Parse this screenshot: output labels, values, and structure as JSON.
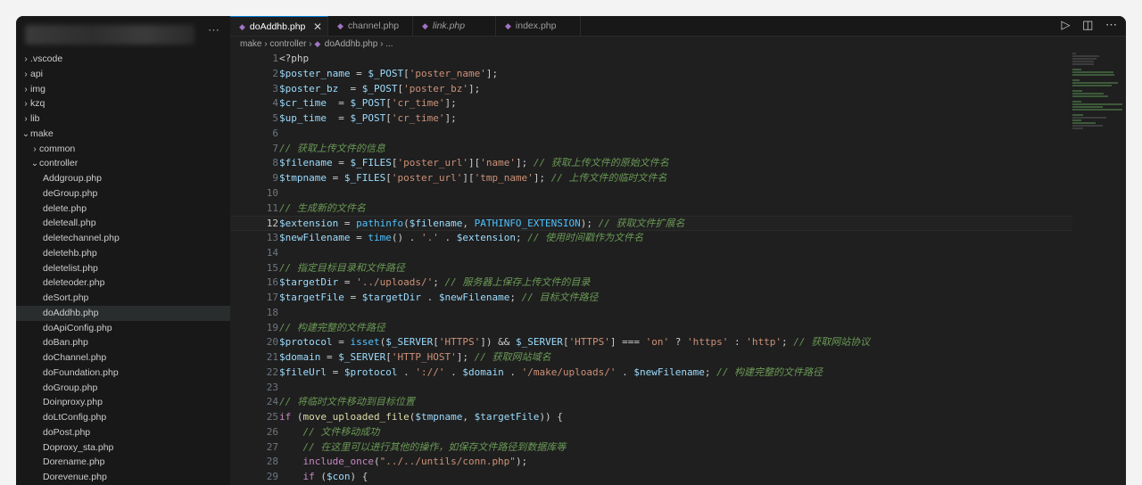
{
  "sidebar": {
    "more_label": "⋯",
    "items": [
      {
        "label": ".vscode",
        "type": "folder",
        "open": false,
        "indent": 0
      },
      {
        "label": "api",
        "type": "folder",
        "open": false,
        "indent": 0
      },
      {
        "label": "img",
        "type": "folder",
        "open": false,
        "indent": 0
      },
      {
        "label": "kzq",
        "type": "folder",
        "open": false,
        "indent": 0
      },
      {
        "label": "lib",
        "type": "folder",
        "open": false,
        "indent": 0
      },
      {
        "label": "make",
        "type": "folder",
        "open": true,
        "indent": 0
      },
      {
        "label": "common",
        "type": "folder",
        "open": false,
        "indent": 1
      },
      {
        "label": "controller",
        "type": "folder",
        "open": true,
        "indent": 1
      },
      {
        "label": "Addgroup.php",
        "type": "file",
        "indent": 2
      },
      {
        "label": "deGroup.php",
        "type": "file",
        "indent": 2
      },
      {
        "label": "delete.php",
        "type": "file",
        "indent": 2
      },
      {
        "label": "deleteall.php",
        "type": "file",
        "indent": 2
      },
      {
        "label": "deletechannel.php",
        "type": "file",
        "indent": 2
      },
      {
        "label": "deletehb.php",
        "type": "file",
        "indent": 2
      },
      {
        "label": "deletelist.php",
        "type": "file",
        "indent": 2
      },
      {
        "label": "deleteoder.php",
        "type": "file",
        "indent": 2
      },
      {
        "label": "deSort.php",
        "type": "file",
        "indent": 2
      },
      {
        "label": "doAddhb.php",
        "type": "file",
        "indent": 2,
        "active": true
      },
      {
        "label": "doApiConfig.php",
        "type": "file",
        "indent": 2
      },
      {
        "label": "doBan.php",
        "type": "file",
        "indent": 2
      },
      {
        "label": "doChannel.php",
        "type": "file",
        "indent": 2
      },
      {
        "label": "doFoundation.php",
        "type": "file",
        "indent": 2
      },
      {
        "label": "doGroup.php",
        "type": "file",
        "indent": 2
      },
      {
        "label": "Doinproxy.php",
        "type": "file",
        "indent": 2
      },
      {
        "label": "doLtConfig.php",
        "type": "file",
        "indent": 2
      },
      {
        "label": "doPost.php",
        "type": "file",
        "indent": 2
      },
      {
        "label": "Doproxy_sta.php",
        "type": "file",
        "indent": 2
      },
      {
        "label": "Dorename.php",
        "type": "file",
        "indent": 2
      },
      {
        "label": "Dorevenue.php",
        "type": "file",
        "indent": 2
      }
    ]
  },
  "tabs": [
    {
      "label": "doAddhb.php",
      "active": true,
      "italic": false,
      "close": "✕"
    },
    {
      "label": "channel.php",
      "active": false,
      "italic": false
    },
    {
      "label": "link.php",
      "active": false,
      "italic": true
    },
    {
      "label": "index.php",
      "active": false,
      "italic": false
    }
  ],
  "editor_actions": {
    "run": "▷",
    "split": "◫",
    "more": "⋯"
  },
  "breadcrumb": {
    "parts": [
      "make",
      "controller"
    ],
    "file": "doAddhb.php",
    "tail": "..."
  },
  "colors": {
    "keyword": "#c586c0",
    "variable": "#9cdcfe",
    "string": "#ce9178",
    "function": "#dcdcaa",
    "builtin": "#4fc1ff",
    "comment": "#6a9955",
    "text": "#cccccc",
    "php_badge": "#a074c4",
    "accent": "#0078d4"
  },
  "current_line": 12,
  "code_lines": [
    [
      [
        "t",
        "<?php"
      ]
    ],
    [
      [
        "v",
        "$poster_name"
      ],
      [
        "t",
        " = "
      ],
      [
        "v",
        "$_POST"
      ],
      [
        "t",
        "["
      ],
      [
        "s",
        "'poster_name'"
      ],
      [
        "t",
        "];"
      ]
    ],
    [
      [
        "v",
        "$poster_bz"
      ],
      [
        "t",
        "  = "
      ],
      [
        "v",
        "$_POST"
      ],
      [
        "t",
        "["
      ],
      [
        "s",
        "'poster_bz'"
      ],
      [
        "t",
        "];"
      ]
    ],
    [
      [
        "v",
        "$cr_time"
      ],
      [
        "t",
        "  = "
      ],
      [
        "v",
        "$_POST"
      ],
      [
        "t",
        "["
      ],
      [
        "s",
        "'cr_time'"
      ],
      [
        "t",
        "];"
      ]
    ],
    [
      [
        "v",
        "$up_time"
      ],
      [
        "t",
        "  = "
      ],
      [
        "v",
        "$_POST"
      ],
      [
        "t",
        "["
      ],
      [
        "s",
        "'cr_time'"
      ],
      [
        "t",
        "];"
      ]
    ],
    [],
    [
      [
        "c",
        "// 获取上传文件的信息"
      ]
    ],
    [
      [
        "v",
        "$filename"
      ],
      [
        "t",
        " = "
      ],
      [
        "v",
        "$_FILES"
      ],
      [
        "t",
        "["
      ],
      [
        "s",
        "'poster_url'"
      ],
      [
        "t",
        "]["
      ],
      [
        "s",
        "'name'"
      ],
      [
        "t",
        "]; "
      ],
      [
        "c",
        "// 获取上传文件的原始文件名"
      ]
    ],
    [
      [
        "v",
        "$tmpname"
      ],
      [
        "t",
        " = "
      ],
      [
        "v",
        "$_FILES"
      ],
      [
        "t",
        "["
      ],
      [
        "s",
        "'poster_url'"
      ],
      [
        "t",
        "]["
      ],
      [
        "s",
        "'tmp_name'"
      ],
      [
        "t",
        "]; "
      ],
      [
        "c",
        "// 上传文件的临时文件名"
      ]
    ],
    [],
    [
      [
        "c",
        "// 生成新的文件名"
      ]
    ],
    [
      [
        "v",
        "$extension"
      ],
      [
        "t",
        " = "
      ],
      [
        "b",
        "pathinfo"
      ],
      [
        "t",
        "("
      ],
      [
        "v",
        "$filename"
      ],
      [
        "t",
        ", "
      ],
      [
        "b",
        "PATHINFO_EXTENSION"
      ],
      [
        "t",
        "); "
      ],
      [
        "c",
        "// 获取文件扩展名"
      ]
    ],
    [
      [
        "v",
        "$newFilename"
      ],
      [
        "t",
        " = "
      ],
      [
        "b",
        "time"
      ],
      [
        "t",
        "() . "
      ],
      [
        "s",
        "'.'"
      ],
      [
        "t",
        " . "
      ],
      [
        "v",
        "$extension"
      ],
      [
        "t",
        "; "
      ],
      [
        "c",
        "// 使用时间戳作为文件名"
      ]
    ],
    [],
    [
      [
        "c",
        "// 指定目标目录和文件路径"
      ]
    ],
    [
      [
        "v",
        "$targetDir"
      ],
      [
        "t",
        " = "
      ],
      [
        "s",
        "'../uploads/'"
      ],
      [
        "t",
        "; "
      ],
      [
        "c",
        "// 服务器上保存上传文件的目录"
      ]
    ],
    [
      [
        "v",
        "$targetFile"
      ],
      [
        "t",
        " = "
      ],
      [
        "v",
        "$targetDir"
      ],
      [
        "t",
        " . "
      ],
      [
        "v",
        "$newFilename"
      ],
      [
        "t",
        "; "
      ],
      [
        "c",
        "// 目标文件路径"
      ]
    ],
    [],
    [
      [
        "c",
        "// 构建完整的文件路径"
      ]
    ],
    [
      [
        "v",
        "$protocol"
      ],
      [
        "t",
        " = "
      ],
      [
        "b",
        "isset"
      ],
      [
        "t",
        "("
      ],
      [
        "v",
        "$_SERVER"
      ],
      [
        "t",
        "["
      ],
      [
        "s",
        "'HTTPS'"
      ],
      [
        "t",
        "]) && "
      ],
      [
        "v",
        "$_SERVER"
      ],
      [
        "t",
        "["
      ],
      [
        "s",
        "'HTTPS'"
      ],
      [
        "t",
        "] === "
      ],
      [
        "s",
        "'on'"
      ],
      [
        "t",
        " ? "
      ],
      [
        "s",
        "'https'"
      ],
      [
        "t",
        " : "
      ],
      [
        "s",
        "'http'"
      ],
      [
        "t",
        "; "
      ],
      [
        "c",
        "// 获取网站协议"
      ]
    ],
    [
      [
        "v",
        "$domain"
      ],
      [
        "t",
        " = "
      ],
      [
        "v",
        "$_SERVER"
      ],
      [
        "t",
        "["
      ],
      [
        "s",
        "'HTTP_HOST'"
      ],
      [
        "t",
        "]; "
      ],
      [
        "c",
        "// 获取网站域名"
      ]
    ],
    [
      [
        "v",
        "$fileUrl"
      ],
      [
        "t",
        " = "
      ],
      [
        "v",
        "$protocol"
      ],
      [
        "t",
        " . "
      ],
      [
        "s",
        "'://'"
      ],
      [
        "t",
        " . "
      ],
      [
        "v",
        "$domain"
      ],
      [
        "t",
        " . "
      ],
      [
        "s",
        "'/make/uploads/'"
      ],
      [
        "t",
        " . "
      ],
      [
        "v",
        "$newFilename"
      ],
      [
        "t",
        "; "
      ],
      [
        "c",
        "// 构建完整的文件路径"
      ]
    ],
    [],
    [
      [
        "c",
        "// 将临时文件移动到目标位置"
      ]
    ],
    [
      [
        "k",
        "if"
      ],
      [
        "t",
        " ("
      ],
      [
        "f",
        "move_uploaded_file"
      ],
      [
        "t",
        "("
      ],
      [
        "v",
        "$tmpname"
      ],
      [
        "t",
        ", "
      ],
      [
        "v",
        "$targetFile"
      ],
      [
        "t",
        ")) {"
      ]
    ],
    [
      [
        "t",
        "    "
      ],
      [
        "c",
        "// 文件移动成功"
      ]
    ],
    [
      [
        "t",
        "    "
      ],
      [
        "c",
        "// 在这里可以进行其他的操作，如保存文件路径到数据库等"
      ]
    ],
    [
      [
        "t",
        "    "
      ],
      [
        "k",
        "include_once"
      ],
      [
        "t",
        "("
      ],
      [
        "s",
        "\"../../untils/conn.php\""
      ],
      [
        "t",
        ");"
      ]
    ],
    [
      [
        "t",
        "    "
      ],
      [
        "k",
        "if"
      ],
      [
        "t",
        " ("
      ],
      [
        "v",
        "$con"
      ],
      [
        "t",
        ") {"
      ]
    ]
  ]
}
